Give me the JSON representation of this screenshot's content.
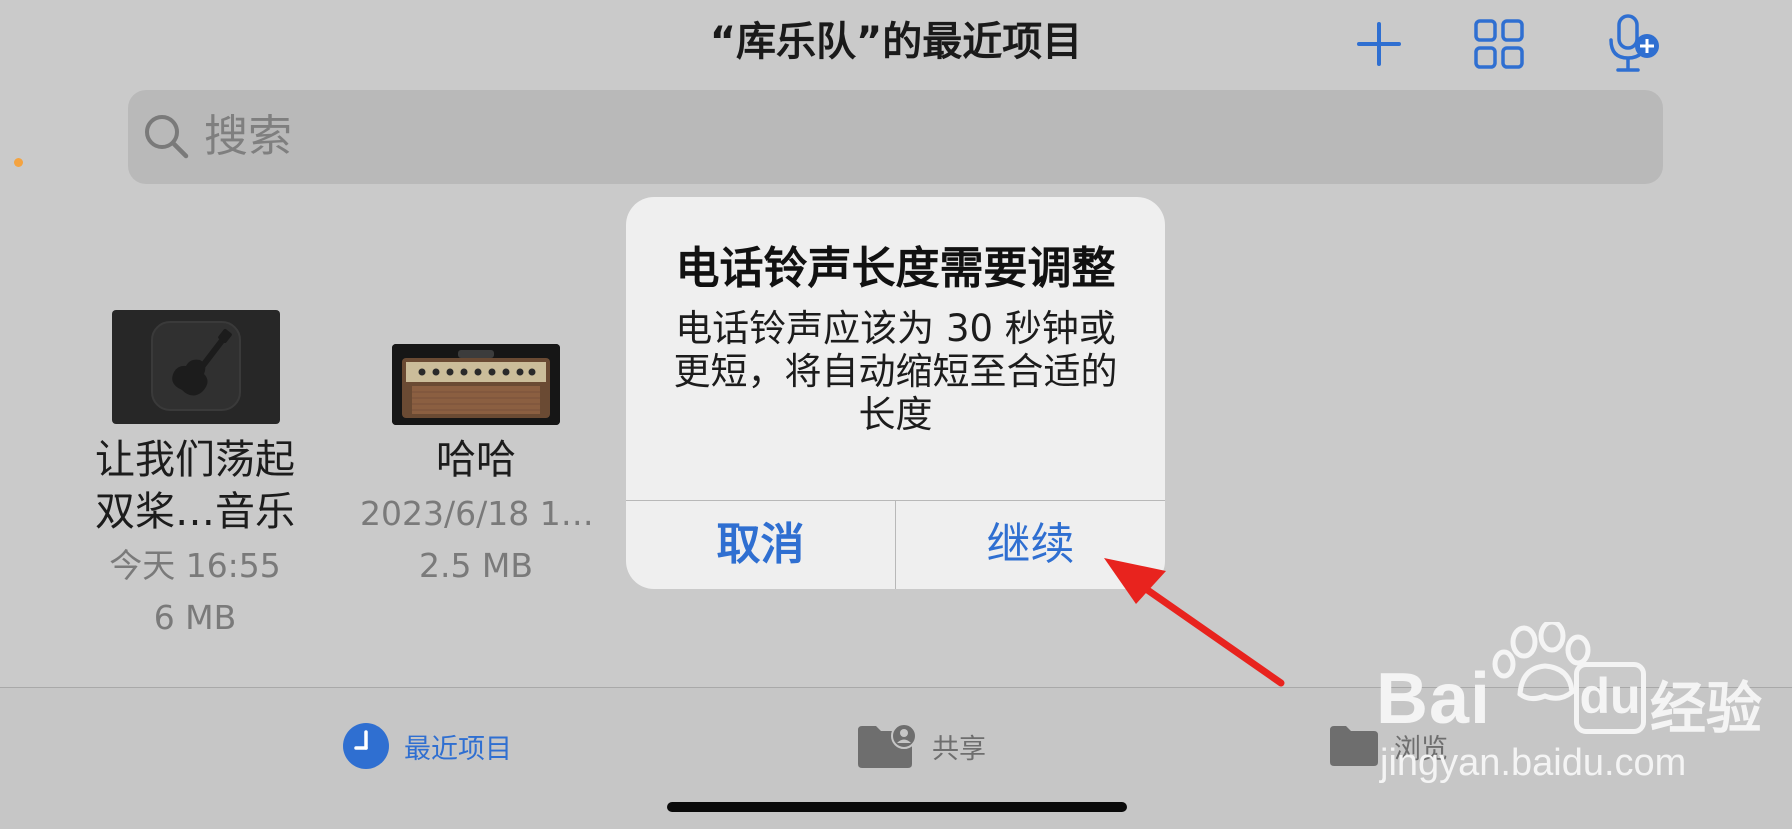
{
  "header": {
    "title": "“库乐队”的最近项目",
    "add_icon": "plus-icon",
    "view_icon": "grid-icon",
    "mic_icon": "mic-add-icon",
    "accent_color": "#2f6fd1"
  },
  "search": {
    "placeholder": "搜索",
    "icon": "search-icon"
  },
  "files": [
    {
      "name_line1": "让我们荡起",
      "name_line2": "双桨…音乐",
      "date": "今天 16:55",
      "size": "6 MB",
      "thumb": "guitar-app-icon"
    },
    {
      "name_line1": "哈哈",
      "date": "2023/6/18 1…",
      "size": "2.5 MB",
      "thumb": "amplifier-thumbnail"
    }
  ],
  "dialog": {
    "title": "电话铃声长度需要调整",
    "message_line1": "电话铃声应该为 30 秒钟或",
    "message_line2": "更短，将自动缩短至合适的",
    "message_line3": "长度",
    "cancel_label": "取消",
    "continue_label": "继续"
  },
  "tabbar": {
    "tabs": [
      {
        "label": "最近项目",
        "icon": "clock-icon",
        "active": true
      },
      {
        "label": "共享",
        "icon": "shared-folder-icon",
        "active": false
      },
      {
        "label": "浏览",
        "icon": "folder-icon",
        "active": false
      }
    ]
  },
  "watermark": {
    "brand_left": "Bai",
    "brand_right": "经验",
    "url": "jingyan.baidu.com"
  }
}
